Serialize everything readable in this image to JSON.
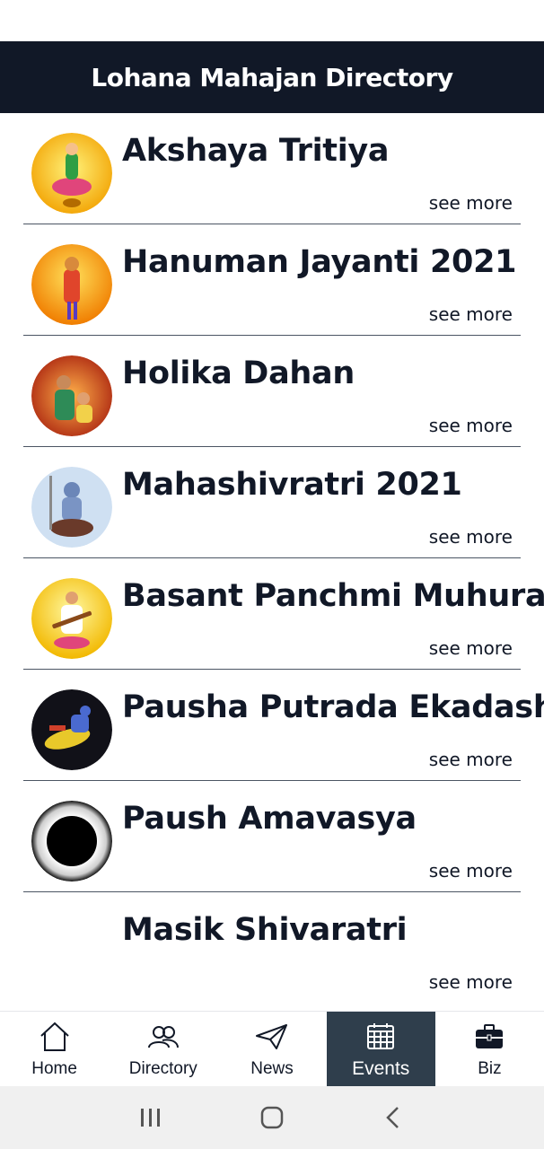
{
  "header": {
    "title": "Lohana Mahajan Directory"
  },
  "events": [
    {
      "title": "Akshaya Tritiya",
      "see_more": "see more",
      "thumb": "lakshmi-image",
      "bg": "#f5b400"
    },
    {
      "title": "Hanuman Jayanti 2021",
      "see_more": "see more",
      "thumb": "hanuman-image",
      "bg": "#f28c00"
    },
    {
      "title": "Holika Dahan",
      "see_more": "see more",
      "thumb": "holika-image",
      "bg": "#d9421a"
    },
    {
      "title": "Mahashivratri 2021",
      "see_more": "see more",
      "thumb": "shiva-image",
      "bg": "#a9c6e8"
    },
    {
      "title": "Basant Panchmi Muhurat",
      "see_more": "see more",
      "thumb": "saraswati-image",
      "bg": "#f7d11a"
    },
    {
      "title": "Pausha Putrada Ekadashi '",
      "see_more": "see more",
      "thumb": "vishnu-image",
      "bg": "#1a1a2a"
    },
    {
      "title": "Paush Amavasya",
      "see_more": "see more",
      "thumb": "eclipse-image",
      "bg": "#ffffff"
    },
    {
      "title": "Masik Shivaratri",
      "see_more": "see more",
      "thumb": "",
      "bg": "#ffffff"
    }
  ],
  "nav": {
    "items": [
      {
        "label": "Home",
        "icon": "home-icon"
      },
      {
        "label": "Directory",
        "icon": "people-icon"
      },
      {
        "label": "News",
        "icon": "send-icon"
      },
      {
        "label": "Events",
        "icon": "calendar-icon",
        "active": true
      },
      {
        "label": "Biz",
        "icon": "briefcase-icon"
      }
    ]
  },
  "colors": {
    "header_bg": "#111827",
    "active_nav_bg": "#2f3e4c",
    "divider": "#4b5563"
  }
}
